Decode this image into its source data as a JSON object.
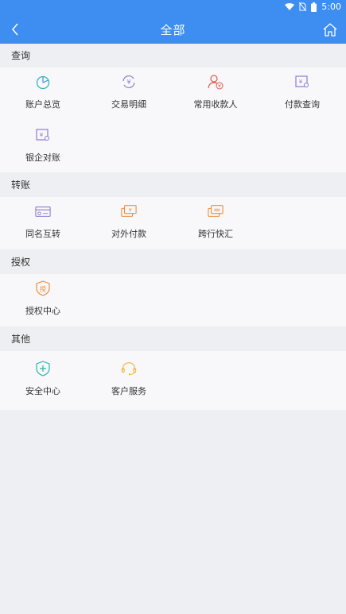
{
  "status_bar": {
    "time": "5:00"
  },
  "nav": {
    "title": "全部"
  },
  "sections": [
    {
      "title": "查询",
      "items": [
        {
          "label": "账户总览",
          "icon": "account-overview-icon"
        },
        {
          "label": "交易明细",
          "icon": "transaction-detail-icon"
        },
        {
          "label": "常用收款人",
          "icon": "payee-icon"
        },
        {
          "label": "付款查询",
          "icon": "payment-query-icon"
        },
        {
          "label": "银企对账",
          "icon": "reconciliation-icon"
        }
      ]
    },
    {
      "title": "转账",
      "items": [
        {
          "label": "同名互转",
          "icon": "same-name-transfer-icon"
        },
        {
          "label": "对外付款",
          "icon": "external-payment-icon"
        },
        {
          "label": "跨行快汇",
          "icon": "interbank-transfer-icon"
        }
      ]
    },
    {
      "title": "授权",
      "items": [
        {
          "label": "授权中心",
          "icon": "authorization-icon",
          "badge": "授"
        }
      ]
    },
    {
      "title": "其他",
      "items": [
        {
          "label": "安全中心",
          "icon": "security-shield-icon"
        },
        {
          "label": "客户服务",
          "icon": "customer-service-headset-icon"
        }
      ]
    }
  ],
  "colors": {
    "primary": "#3d8ef0",
    "teal": "#2ab3b3",
    "purple": "#8f7ad6",
    "orange": "#f08c3a",
    "red": "#e0584a",
    "gold": "#f2b23a"
  }
}
